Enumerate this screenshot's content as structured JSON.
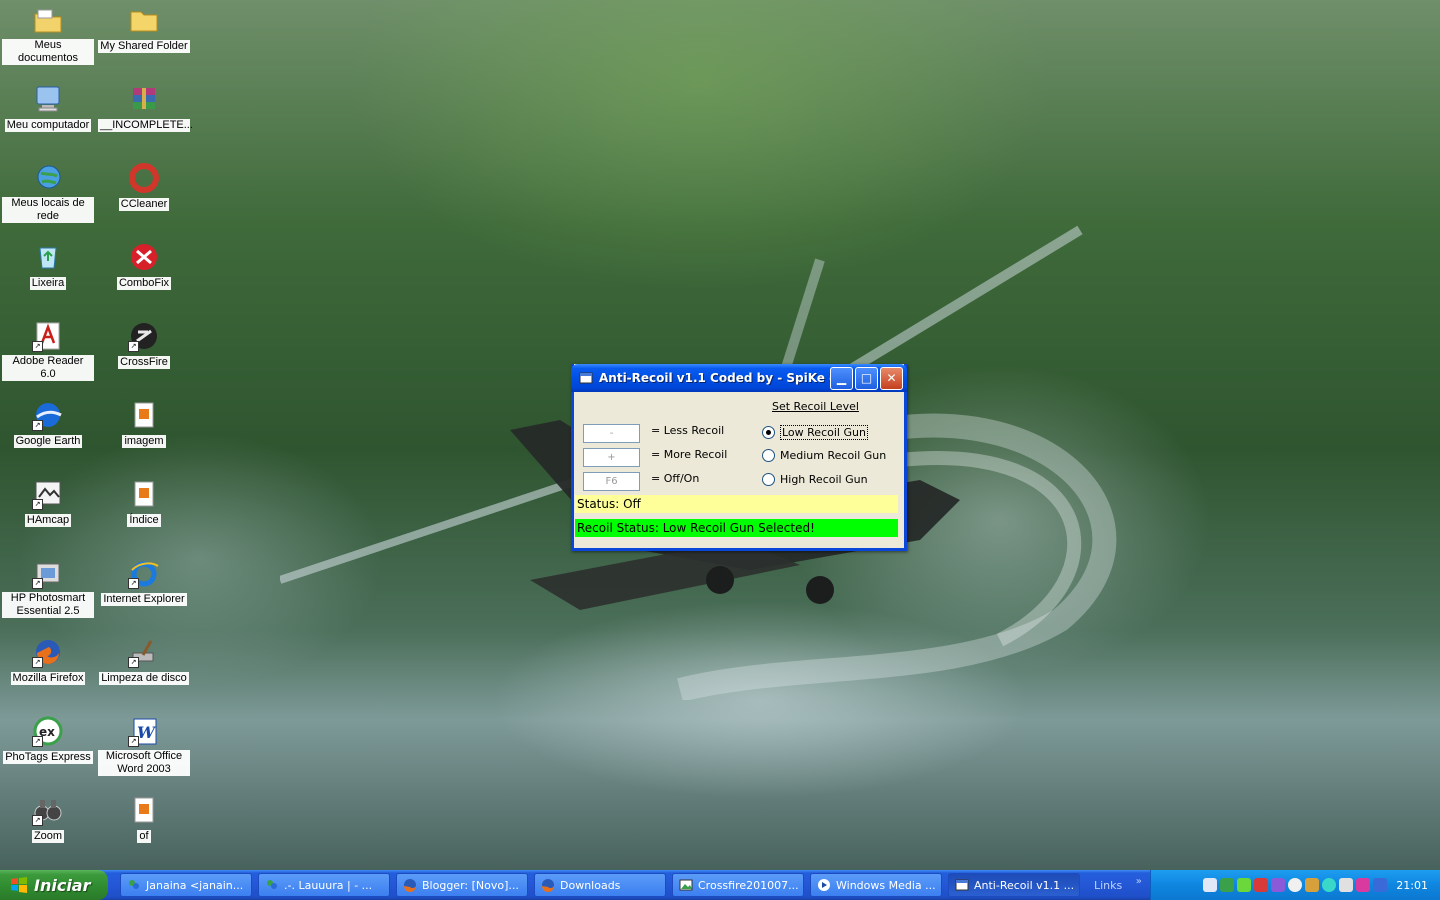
{
  "desktop": {
    "icons": [
      {
        "label": "Meus documentos",
        "x": 0
      },
      {
        "label": "My Shared Folder"
      },
      {
        "label": "Meu computador"
      },
      {
        "label": "__INCOMPLETE..."
      },
      {
        "label": "Meus locais de rede"
      },
      {
        "label": "CCleaner"
      },
      {
        "label": "Lixeira"
      },
      {
        "label": "ComboFix"
      },
      {
        "label": "Adobe Reader 6.0"
      },
      {
        "label": "CrossFire"
      },
      {
        "label": "Google Earth"
      },
      {
        "label": "imagem"
      },
      {
        "label": "HAmcap"
      },
      {
        "label": "Índice"
      },
      {
        "label": "HP Photosmart Essential 2.5"
      },
      {
        "label": "Internet Explorer"
      },
      {
        "label": "Mozilla Firefox"
      },
      {
        "label": "Limpeza de disco"
      },
      {
        "label": "PhoTags Express"
      },
      {
        "label": "Microsoft Office Word 2003"
      },
      {
        "label": "Zoom"
      },
      {
        "label": "of"
      }
    ]
  },
  "dialog": {
    "title": "Anti-Recoil v1.1 Coded by - SpiKe -",
    "set_recoil_level": "Set Recoil Level",
    "fields": [
      {
        "value": "-",
        "label": "= Less Recoil"
      },
      {
        "value": "+",
        "label": "= More Recoil"
      },
      {
        "value": "F6",
        "label": "= Off/On"
      }
    ],
    "radios": [
      {
        "label": "Low Recoil Gun",
        "selected": true
      },
      {
        "label": "Medium Recoil Gun",
        "selected": false
      },
      {
        "label": "High Recoil Gun",
        "selected": false
      }
    ],
    "status": "Status: Off",
    "recoil_status": "Recoil Status: Low Recoil Gun Selected!",
    "colors": {
      "status_bg": "#ffff99",
      "recoil_bg": "#00ff00"
    }
  },
  "taskbar": {
    "start_label": "Iniciar",
    "tasks": [
      {
        "label": "Janaina <janain..."
      },
      {
        "label": ".-. Lauuura | - ..."
      },
      {
        "label": "Blogger: [Novo]..."
      },
      {
        "label": "Downloads"
      },
      {
        "label": "Crossfire201007..."
      },
      {
        "label": "Windows Media ..."
      },
      {
        "label": "Anti-Recoil v1.1 ..."
      }
    ],
    "links_label": "Links",
    "links_chevron": "»",
    "clock": "21:01"
  }
}
